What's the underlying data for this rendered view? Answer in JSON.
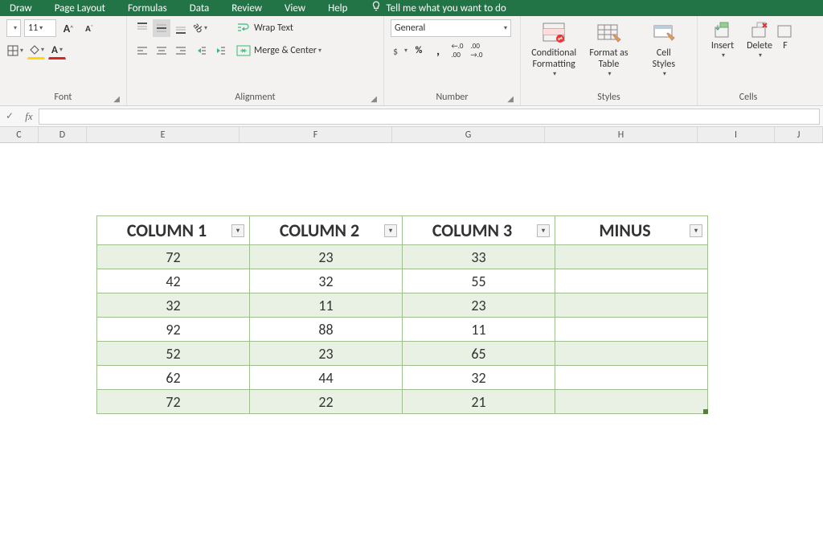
{
  "menu": {
    "items": [
      "Draw",
      "Page Layout",
      "Formulas",
      "Data",
      "Review",
      "View",
      "Help"
    ],
    "tellme": "Tell me what you want to do"
  },
  "font": {
    "size": "11",
    "grow": "A",
    "shrink": "A"
  },
  "alignment": {
    "wrap": "Wrap Text",
    "merge": "Merge & Center",
    "label": "Alignment"
  },
  "number": {
    "format": "General",
    "label": "Number"
  },
  "styles": {
    "cond": "Conditional\nFormatting",
    "fmt": "Format as\nTable",
    "cell": "Cell\nStyles",
    "label": "Styles"
  },
  "cells": {
    "insert": "Insert",
    "delete": "Delete",
    "label": "Cells"
  },
  "groups": {
    "font": "Font"
  },
  "fbar": {
    "fx": "fx"
  },
  "colheads": [
    {
      "l": "C",
      "w": 48
    },
    {
      "l": "D",
      "w": 60
    },
    {
      "l": "E",
      "w": 190
    },
    {
      "l": "F",
      "w": 190
    },
    {
      "l": "G",
      "w": 190
    },
    {
      "l": "H",
      "w": 190
    },
    {
      "l": "I",
      "w": 96
    },
    {
      "l": "J",
      "w": 60
    }
  ],
  "table": {
    "headers": [
      "COLUMN 1",
      "COLUMN 2",
      "COLUMN 3",
      "MINUS"
    ],
    "rows": [
      [
        "72",
        "23",
        "33",
        ""
      ],
      [
        "42",
        "32",
        "55",
        ""
      ],
      [
        "32",
        "11",
        "23",
        ""
      ],
      [
        "92",
        "88",
        "11",
        ""
      ],
      [
        "52",
        "23",
        "65",
        ""
      ],
      [
        "62",
        "44",
        "32",
        ""
      ],
      [
        "72",
        "22",
        "21",
        ""
      ]
    ]
  }
}
